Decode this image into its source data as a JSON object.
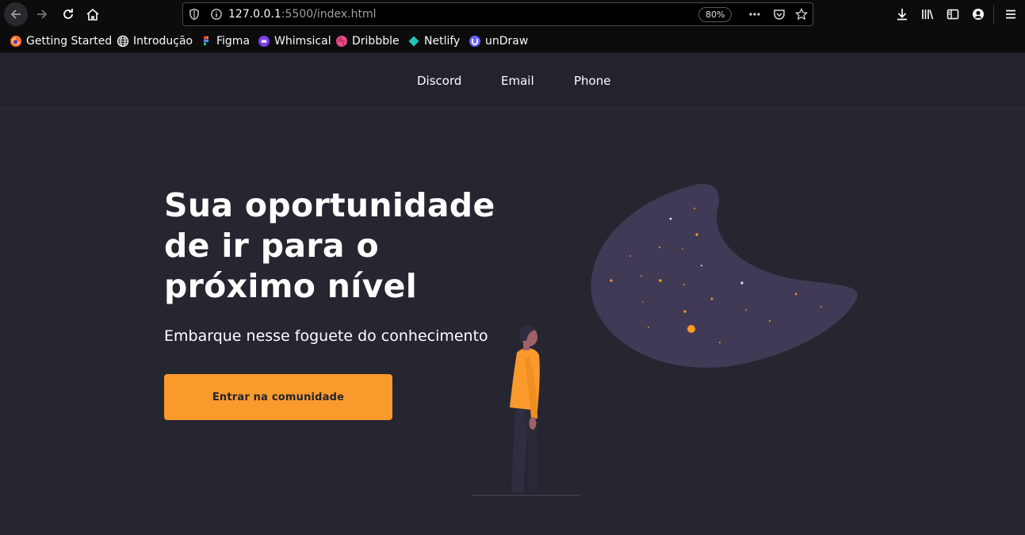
{
  "browser": {
    "url_host": "127.0.0.1",
    "url_path": ":5500/index.html",
    "zoom": "80%"
  },
  "bookmarks": [
    {
      "label": "Getting Started",
      "icon": "firefox-icon",
      "color": "#ff7139"
    },
    {
      "label": "Introdução",
      "icon": "globe-icon",
      "color": "#f9f9fa"
    },
    {
      "label": "Figma",
      "icon": "figma-icon",
      "color": "#f24e1e"
    },
    {
      "label": "Whimsical",
      "icon": "whimsical-icon",
      "color": "#7b3fe4"
    },
    {
      "label": "Dribbble",
      "icon": "dribbble-icon",
      "color": "#ea4c89"
    },
    {
      "label": "Netlify",
      "icon": "netlify-icon",
      "color": "#20c6b7"
    },
    {
      "label": "unDraw",
      "icon": "undraw-icon",
      "color": "#6c63ff"
    }
  ],
  "nav": {
    "links": [
      "Discord",
      "Email",
      "Phone"
    ]
  },
  "hero": {
    "title": "Sua oportunidade de ir para o próximo nível",
    "subtitle": "Embarque nesse foguete do conhecimento",
    "cta_label": "Entrar na comunidade"
  },
  "colors": {
    "background": "#262631",
    "header": "#23232e",
    "accent": "#fa9a2c",
    "blob": "#413a56"
  }
}
